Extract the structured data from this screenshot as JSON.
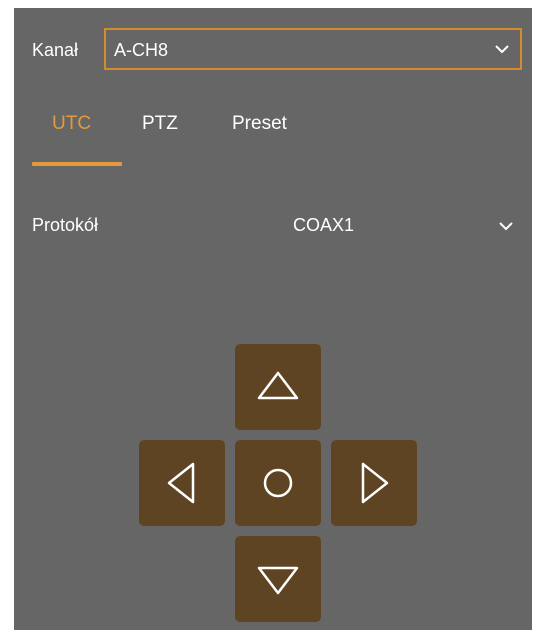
{
  "channel": {
    "label": "Kanał",
    "value": "A-CH8"
  },
  "tabs": [
    {
      "label": "UTC",
      "active": true
    },
    {
      "label": "PTZ",
      "active": false
    },
    {
      "label": "Preset",
      "active": false
    }
  ],
  "protocol": {
    "label": "Protokół",
    "value": "COAX1"
  },
  "dpad": {
    "up_icon": "triangle-up-icon",
    "left_icon": "triangle-left-icon",
    "center_icon": "circle-icon",
    "right_icon": "triangle-right-icon",
    "down_icon": "triangle-down-icon"
  },
  "colors": {
    "panel_bg": "#666666",
    "accent": "#e29a3d",
    "select_border": "#d68a2b",
    "pad_button": "#5e4423",
    "text": "#ffffff"
  }
}
